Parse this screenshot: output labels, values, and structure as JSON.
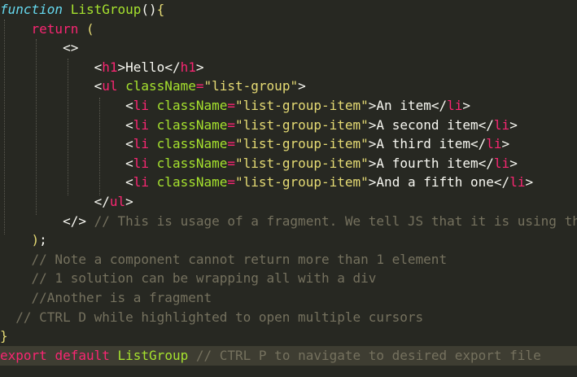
{
  "lines": [
    [
      {
        "t": "function",
        "c": "kw"
      },
      {
        "t": " ",
        "c": "pn"
      },
      {
        "t": "ListGroup",
        "c": "fn"
      },
      {
        "t": "()",
        "c": "pn"
      },
      {
        "t": "{",
        "c": "br"
      }
    ],
    [
      {
        "t": "    ",
        "c": "pn"
      },
      {
        "t": "return",
        "c": "ret"
      },
      {
        "t": " ",
        "c": "pn"
      },
      {
        "t": "(",
        "c": "br"
      }
    ],
    [
      {
        "t": "        ",
        "c": "pn"
      },
      {
        "t": "<>",
        "c": "pn"
      }
    ],
    [
      {
        "t": "            ",
        "c": "pn"
      },
      {
        "t": "<",
        "c": "pn"
      },
      {
        "t": "h1",
        "c": "tag"
      },
      {
        "t": ">",
        "c": "pn"
      },
      {
        "t": "Hello",
        "c": "txt"
      },
      {
        "t": "</",
        "c": "pn"
      },
      {
        "t": "h1",
        "c": "tag"
      },
      {
        "t": ">",
        "c": "pn"
      }
    ],
    [
      {
        "t": "            ",
        "c": "pn"
      },
      {
        "t": "<",
        "c": "pn"
      },
      {
        "t": "ul",
        "c": "tag"
      },
      {
        "t": " ",
        "c": "pn"
      },
      {
        "t": "className",
        "c": "attr"
      },
      {
        "t": "=",
        "c": "eq"
      },
      {
        "t": "\"list-group\"",
        "c": "str"
      },
      {
        "t": ">",
        "c": "pn"
      }
    ],
    [
      {
        "t": "                ",
        "c": "pn"
      },
      {
        "t": "<",
        "c": "pn"
      },
      {
        "t": "li",
        "c": "tag"
      },
      {
        "t": " ",
        "c": "pn"
      },
      {
        "t": "className",
        "c": "attr"
      },
      {
        "t": "=",
        "c": "eq"
      },
      {
        "t": "\"list-group-item\"",
        "c": "str"
      },
      {
        "t": ">",
        "c": "pn"
      },
      {
        "t": "An item",
        "c": "txt"
      },
      {
        "t": "</",
        "c": "pn"
      },
      {
        "t": "li",
        "c": "tag"
      },
      {
        "t": ">",
        "c": "pn"
      }
    ],
    [
      {
        "t": "                ",
        "c": "pn"
      },
      {
        "t": "<",
        "c": "pn"
      },
      {
        "t": "li",
        "c": "tag"
      },
      {
        "t": " ",
        "c": "pn"
      },
      {
        "t": "className",
        "c": "attr"
      },
      {
        "t": "=",
        "c": "eq"
      },
      {
        "t": "\"list-group-item\"",
        "c": "str"
      },
      {
        "t": ">",
        "c": "pn"
      },
      {
        "t": "A second item",
        "c": "txt"
      },
      {
        "t": "</",
        "c": "pn"
      },
      {
        "t": "li",
        "c": "tag"
      },
      {
        "t": ">",
        "c": "pn"
      }
    ],
    [
      {
        "t": "                ",
        "c": "pn"
      },
      {
        "t": "<",
        "c": "pn"
      },
      {
        "t": "li",
        "c": "tag"
      },
      {
        "t": " ",
        "c": "pn"
      },
      {
        "t": "className",
        "c": "attr"
      },
      {
        "t": "=",
        "c": "eq"
      },
      {
        "t": "\"list-group-item\"",
        "c": "str"
      },
      {
        "t": ">",
        "c": "pn"
      },
      {
        "t": "A third item",
        "c": "txt"
      },
      {
        "t": "</",
        "c": "pn"
      },
      {
        "t": "li",
        "c": "tag"
      },
      {
        "t": ">",
        "c": "pn"
      }
    ],
    [
      {
        "t": "                ",
        "c": "pn"
      },
      {
        "t": "<",
        "c": "pn"
      },
      {
        "t": "li",
        "c": "tag"
      },
      {
        "t": " ",
        "c": "pn"
      },
      {
        "t": "className",
        "c": "attr"
      },
      {
        "t": "=",
        "c": "eq"
      },
      {
        "t": "\"list-group-item\"",
        "c": "str"
      },
      {
        "t": ">",
        "c": "pn"
      },
      {
        "t": "A fourth item",
        "c": "txt"
      },
      {
        "t": "</",
        "c": "pn"
      },
      {
        "t": "li",
        "c": "tag"
      },
      {
        "t": ">",
        "c": "pn"
      }
    ],
    [
      {
        "t": "                ",
        "c": "pn"
      },
      {
        "t": "<",
        "c": "pn"
      },
      {
        "t": "li",
        "c": "tag"
      },
      {
        "t": " ",
        "c": "pn"
      },
      {
        "t": "className",
        "c": "attr"
      },
      {
        "t": "=",
        "c": "eq"
      },
      {
        "t": "\"list-group-item\"",
        "c": "str"
      },
      {
        "t": ">",
        "c": "pn"
      },
      {
        "t": "And a fifth one",
        "c": "txt"
      },
      {
        "t": "</",
        "c": "pn"
      },
      {
        "t": "li",
        "c": "tag"
      },
      {
        "t": ">",
        "c": "pn"
      }
    ],
    [
      {
        "t": "            ",
        "c": "pn"
      },
      {
        "t": "</",
        "c": "pn"
      },
      {
        "t": "ul",
        "c": "tag"
      },
      {
        "t": ">",
        "c": "pn"
      }
    ],
    [
      {
        "t": "        ",
        "c": "pn"
      },
      {
        "t": "</>",
        "c": "pn"
      },
      {
        "t": " // This is usage of a fragment. We tell JS that it is using th",
        "c": "cm"
      }
    ],
    [
      {
        "t": "    ",
        "c": "pn"
      },
      {
        "t": ")",
        "c": "br"
      },
      {
        "t": ";",
        "c": "pn"
      }
    ],
    [
      {
        "t": "    // Note a component cannot return more than 1 element",
        "c": "cm"
      }
    ],
    [
      {
        "t": "    // 1 solution can be wrapping all with a div",
        "c": "cm"
      }
    ],
    [
      {
        "t": "    //Another is a fragment",
        "c": "cm"
      }
    ],
    [
      {
        "t": "  // CTRL D while highlighted to open multiple cursors",
        "c": "cm"
      }
    ],
    [
      {
        "t": "}",
        "c": "br"
      }
    ],
    [
      {
        "t": "export",
        "c": "ret"
      },
      {
        "t": " ",
        "c": "pn"
      },
      {
        "t": "default",
        "c": "ret"
      },
      {
        "t": " ",
        "c": "pn"
      },
      {
        "t": "ListGroup",
        "c": "fn"
      },
      {
        "t": " // CTRL P to navigate to desired export file",
        "c": "cm"
      }
    ]
  ],
  "highlighted_line": 18,
  "colors": {
    "background": "#272822",
    "line_highlight": "#3e3d32",
    "keyword": "#66d9ef",
    "tag": "#f92672",
    "attribute": "#a6e22e",
    "string": "#e6db74",
    "comment": "#75715e",
    "text": "#f8f8f2"
  }
}
